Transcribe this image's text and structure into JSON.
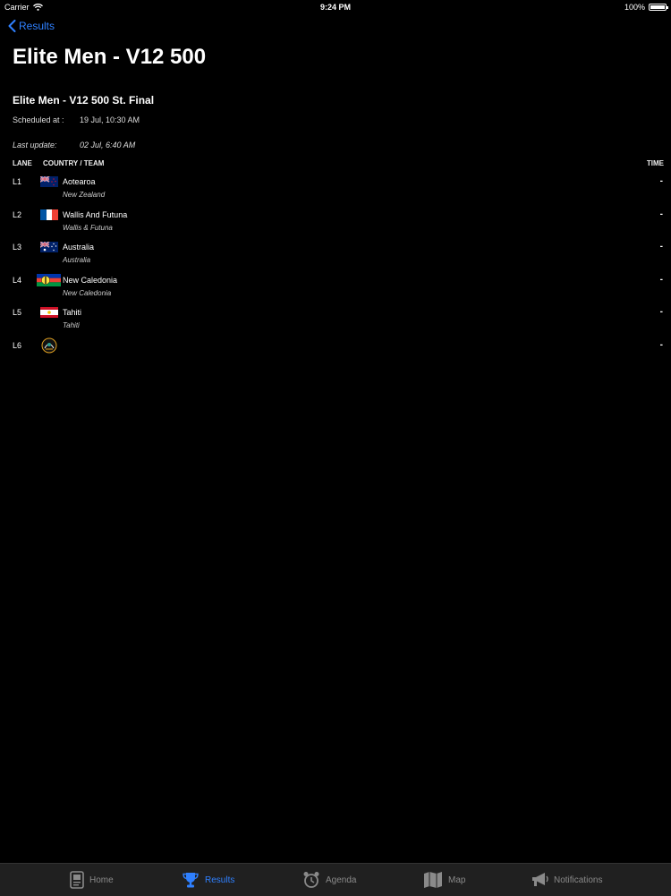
{
  "status_bar": {
    "carrier": "Carrier",
    "time": "9:24 PM",
    "battery": "100%"
  },
  "nav": {
    "back_label": "Results"
  },
  "page": {
    "title": "Elite Men - V12 500"
  },
  "race": {
    "name": "Elite Men - V12 500 St. Final",
    "scheduled_label": "Scheduled at :",
    "scheduled_value": "19 Jul, 10:30 AM",
    "update_label": "Last update:",
    "update_value": "02 Jul, 6:40 AM"
  },
  "table": {
    "headers": {
      "lane": "LANE",
      "team": "COUNTRY / TEAM",
      "time": "TIME"
    },
    "rows": [
      {
        "lane": "L1",
        "name": "Aotearoa",
        "sub": "New Zealand",
        "time": "-",
        "flag": "new-zealand-flag"
      },
      {
        "lane": "L2",
        "name": "Wallis And Futuna",
        "sub": "Wallis & Futuna",
        "time": "-",
        "flag": "france-flag"
      },
      {
        "lane": "L3",
        "name": "Australia",
        "sub": "Australia",
        "time": "-",
        "flag": "australia-flag"
      },
      {
        "lane": "L4",
        "name": "New Caledonia",
        "sub": "New Caledonia",
        "time": "-",
        "flag": "new-caledonia-flag"
      },
      {
        "lane": "L5",
        "name": "Tahiti",
        "sub": "Tahiti",
        "time": "-",
        "flag": "tahiti-flag"
      },
      {
        "lane": "L6",
        "name": "",
        "sub": "",
        "time": "-",
        "flag": "team-emblem-icon"
      }
    ]
  },
  "tabs": [
    {
      "label": "Home",
      "icon": "home-icon"
    },
    {
      "label": "Results",
      "icon": "trophy-icon",
      "active": true
    },
    {
      "label": "Agenda",
      "icon": "alarm-clock-icon"
    },
    {
      "label": "Map",
      "icon": "map-icon"
    },
    {
      "label": "Notifications",
      "icon": "megaphone-icon"
    }
  ],
  "colors": {
    "accent": "#2f80ff",
    "background": "#000000",
    "tab_bar": "#202020",
    "inactive": "#8a8a8a"
  }
}
